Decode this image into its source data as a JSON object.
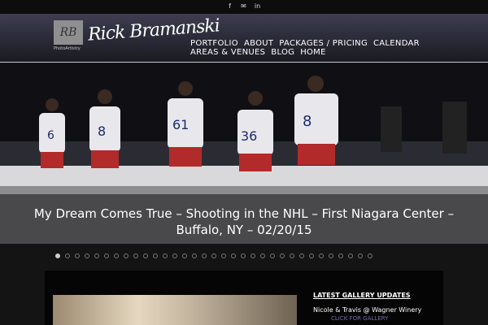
{
  "topbar": {
    "social_icons": [
      "facebook-icon",
      "email-icon",
      "linkedin-icon"
    ],
    "social_glyphs": [
      "f",
      "✉",
      "in"
    ]
  },
  "brand": {
    "logo_text": "RB",
    "logo_sub": "PhotoArtistry",
    "signature": "Rick Bramanski"
  },
  "nav": {
    "items": [
      "PORTFOLIO",
      "ABOUT",
      "PACKAGES / PRICING",
      "CALENDAR",
      "AREAS & VENUES",
      "BLOG",
      "HOME"
    ]
  },
  "hero": {
    "caption_line1": "My Dream Comes True – Shooting in the NHL – First Niagara Center –",
    "caption_line2": "Buffalo, NY – 02/20/15",
    "players": [
      "6",
      "8",
      "61",
      "36",
      "8"
    ],
    "slide_count": 33,
    "active_slide": 1
  },
  "sidebar": {
    "heading": "LATEST GALLERY UPDATES",
    "item": "Nicole & Travis @ Wagner Winery",
    "link": "CLICK FOR GALLERY"
  },
  "colors": {
    "header_top": "#3f3d50",
    "accent_link": "#6e6ea8"
  }
}
